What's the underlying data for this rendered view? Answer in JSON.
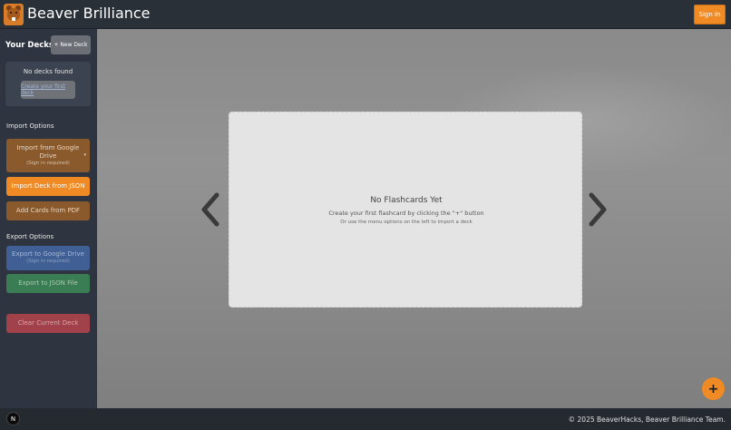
{
  "header": {
    "app_title": "Beaver Brilliance",
    "sign_in_label": "Sign In"
  },
  "sidebar": {
    "decks_title": "Your Decks",
    "new_deck_label": "+ New Deck",
    "empty_state": {
      "message": "No decks found",
      "create_link": "Create your first deck"
    },
    "import_section": {
      "label": "Import Options",
      "google_drive": {
        "label": "Import from Google Drive",
        "sub": "(Sign in required)"
      },
      "json_label": "Import Deck from JSON",
      "pdf_label": "Add Cards from PDF"
    },
    "export_section": {
      "label": "Export Options",
      "google_drive": {
        "label": "Export to Google Drive",
        "sub": "(Sign in required)"
      },
      "json_label": "Export to JSON File"
    },
    "clear_label": "Clear Current Deck"
  },
  "main": {
    "card": {
      "title": "No Flashcards Yet",
      "line1": "Create your first flashcard by clicking the \"+\" button",
      "line2": "Or use the menu options on the left to import a deck"
    },
    "fab_label": "+"
  },
  "footer": {
    "badge": "N",
    "copyright": "© 2025 BeaverHacks, Beaver Brilliance Team."
  },
  "colors": {
    "accent": "#f08a24",
    "header_bg": "#2a3038",
    "sidebar_bg": "#2f3540"
  },
  "icons": {
    "logo": "beaver-logo-icon",
    "prev": "chevron-left-icon",
    "next": "chevron-right-icon",
    "dropdown": "caret-down-icon"
  }
}
